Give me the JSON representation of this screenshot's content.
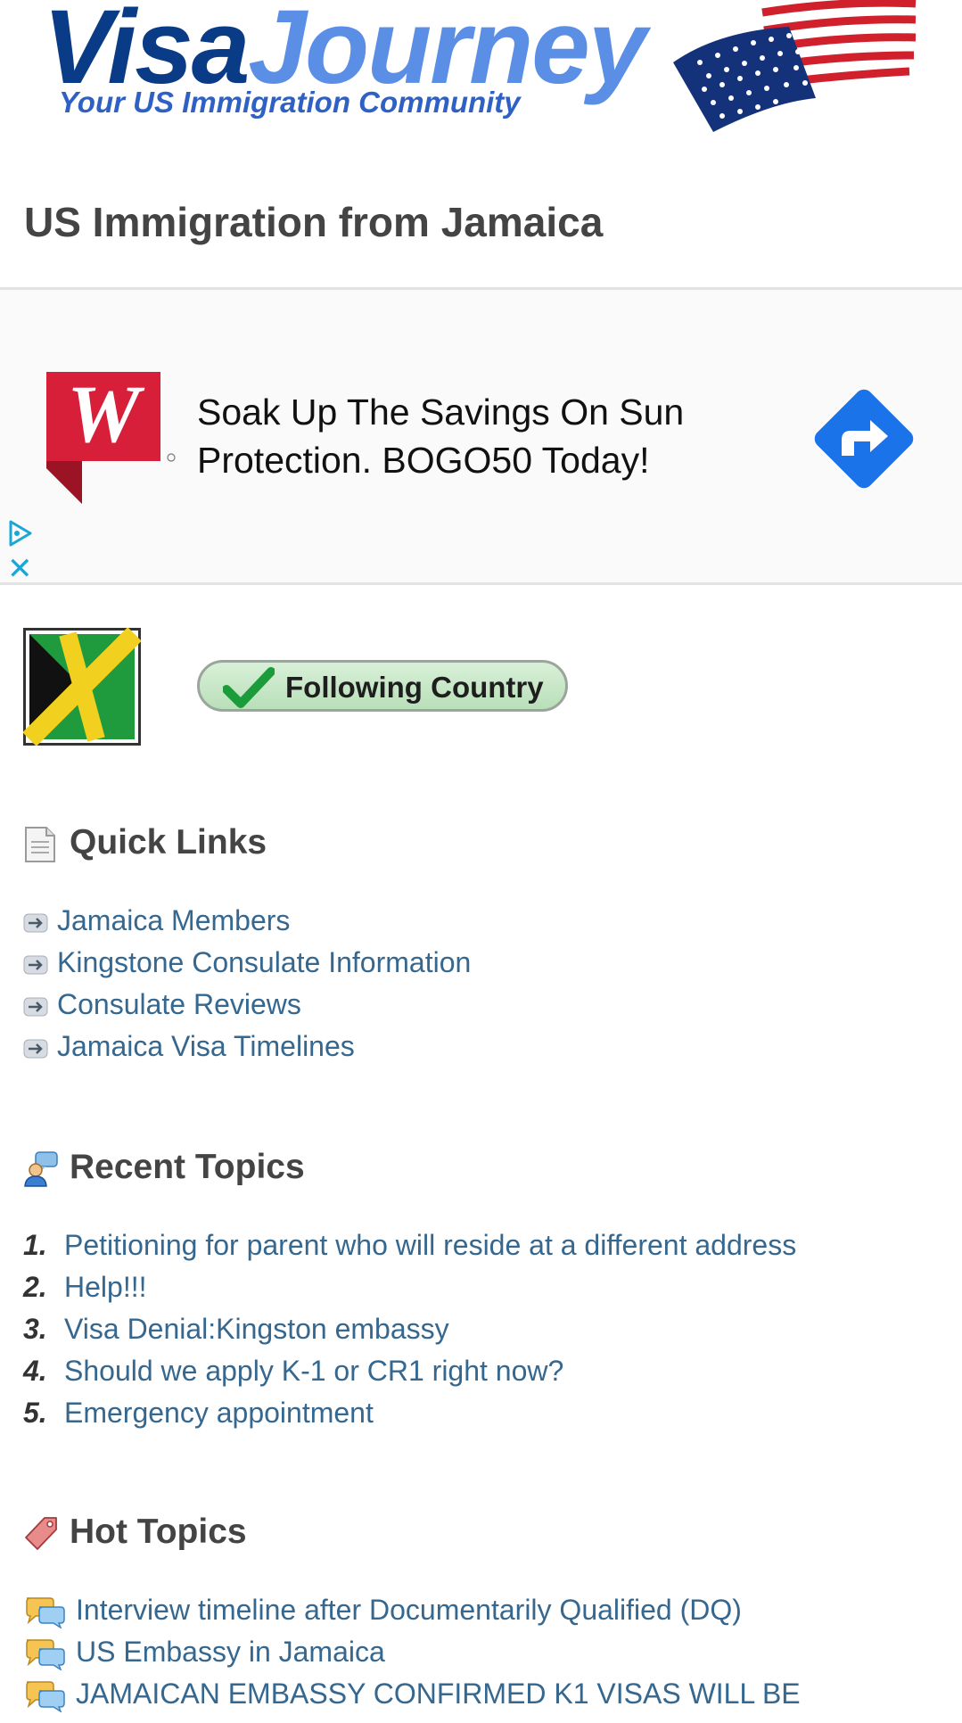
{
  "header": {
    "logo_visa": "Visa",
    "logo_journey": "Journey",
    "logo_tagline": "Your US Immigration Community",
    "page_title": "US Immigration from Jamaica"
  },
  "ad": {
    "brand_letter": "W",
    "headline": "Soak Up The Savings On Sun Protection. BOGO50 Today!",
    "close_symbol": "✕",
    "colors": {
      "brand": "#d71f3a",
      "arrow": "#1a73e8",
      "choices": "#1aa6d6"
    }
  },
  "country": {
    "flag_icon": "jamaica-flag-icon",
    "follow_label": "Following Country"
  },
  "quick_links": {
    "title": "Quick Links",
    "items": [
      {
        "label": "Jamaica Members"
      },
      {
        "label": "Kingstone Consulate Information"
      },
      {
        "label": "Consulate Reviews"
      },
      {
        "label": "Jamaica Visa Timelines"
      }
    ]
  },
  "recent_topics": {
    "title": "Recent Topics",
    "items": [
      {
        "num": "1.",
        "label": "Petitioning for parent who will reside at a different address"
      },
      {
        "num": "2.",
        "label": "Help!!!"
      },
      {
        "num": "3.",
        "label": "Visa Denial:Kingston embassy"
      },
      {
        "num": "4.",
        "label": "Should we apply K-1 or CR1 right now?"
      },
      {
        "num": "5.",
        "label": "Emergency appointment"
      }
    ]
  },
  "hot_topics": {
    "title": "Hot Topics",
    "items": [
      {
        "label": "Interview timeline after Documentarily Qualified (DQ)"
      },
      {
        "label": "US Embassy in Jamaica"
      },
      {
        "label": "JAMAICAN EMBASSY CONFIRMED K1 VISAS WILL BE"
      }
    ]
  },
  "colors": {
    "link": "#35678f",
    "heading": "#444444",
    "logo_dark": "#0a3b86",
    "logo_light": "#5b8fe6"
  }
}
